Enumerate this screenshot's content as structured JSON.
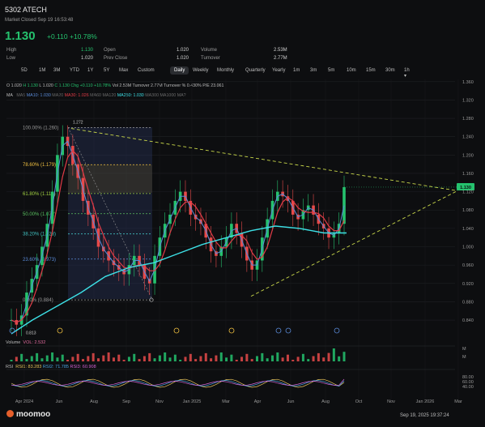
{
  "header": {
    "title": "5302  ATECH",
    "status": "Market Closed Sep 19 16:53:48",
    "price": "1.130",
    "change": "+0.110",
    "change_pct": "+10.78%"
  },
  "quote": {
    "high_label": "High",
    "high": "1.130",
    "low_label": "Low",
    "low": "1.020",
    "open_label": "Open",
    "open": "1.020",
    "prev_close_label": "Prev Close",
    "prev_close": "1.020",
    "volume_label": "Volume",
    "volume": "2.53M",
    "turnover_label": "Turnover",
    "turnover": "2.77M"
  },
  "tabs": [
    "5D",
    "1M",
    "3M",
    "YTD",
    "1Y",
    "5Y",
    "Max",
    "Custom",
    "Daily",
    "Weekly",
    "Monthly",
    "Quarterly",
    "Yearly",
    "1m",
    "3m",
    "5m",
    "10m",
    "15m",
    "30m",
    "1h ▾"
  ],
  "active_tab": "Daily",
  "info_line": {
    "o": "O 1.020",
    "h": "H 1.130",
    "l": "L 1.020",
    "c": "C 1.130",
    "chg": "Chg +0.110 +10.78%",
    "vol": "Vol 2.53M",
    "turnover": "Turnover 2.77M",
    "turnover_pct": "Turnover % 0.430%",
    "pe": "P/E 23.061"
  },
  "ma_line": {
    "ma": "MA",
    "ma5": "MA5",
    "ma10": "MA10: 1.030",
    "ma20": "MA20",
    "ma30": "MA30: 1.026",
    "ma60": "MA60",
    "ma120": "MA120",
    "ma250": "MA250: 1.030",
    "ma300": "MA300",
    "ma1000": "MA1000",
    "ma_x": "MA?"
  },
  "volume_label": "Volume",
  "vol_value": "VOL: 2.532",
  "rsi_label": "RSI",
  "rsi1": "RSI1: 83.283",
  "rsi2": "RSI2: 71.785",
  "rsi3": "RSI3: 60.908",
  "footer": {
    "logo": "moomoo",
    "timestamp": "Sep 19, 2025 19:37:24"
  },
  "colors": {
    "up": "#25c26e",
    "down": "#e74a4a",
    "ma10": "#5a8bd8",
    "ma30": "#e23b47",
    "ma250": "#3de0e6",
    "fib": "#f0c040",
    "trend": "#c9d84a"
  },
  "chart_data": {
    "type": "candlestick",
    "x_ticks": [
      "Apr 2024",
      "Jun",
      "Aug",
      "Sep",
      "Nov",
      "Jan 2025",
      "Mar",
      "Apr",
      "Jun",
      "Aug",
      "Oct",
      "Nov",
      "Jan 2026",
      "Mar"
    ],
    "y_ticks": [
      1.36,
      1.32,
      1.28,
      1.24,
      1.2,
      1.16,
      1.12,
      1.08,
      1.04,
      1.0,
      0.96,
      0.92,
      0.88,
      0.84
    ],
    "ylim": [
      0.81,
      1.365
    ],
    "last_price_tag": "1.130",
    "high_marker": "1.272",
    "low_marker": "0.813",
    "fibonacci": [
      {
        "label": "100.00% (1.260)",
        "value": 1.26
      },
      {
        "label": "78.60% (1.179)",
        "value": 1.179
      },
      {
        "label": "61.80% (1.116)",
        "value": 1.116
      },
      {
        "label": "50.00% (1.072)",
        "value": 1.072
      },
      {
        "label": "38.20% (1.028)",
        "value": 1.028
      },
      {
        "label": "23.60% (0.973)",
        "value": 0.973
      },
      {
        "label": "0.00% (0.884)",
        "value": 0.884
      }
    ],
    "close_series": [
      0.84,
      0.83,
      0.85,
      0.9,
      0.93,
      0.96,
      1.0,
      1.05,
      1.12,
      1.2,
      1.24,
      1.22,
      1.18,
      1.15,
      1.1,
      1.07,
      1.04,
      1.0,
      0.99,
      0.97,
      0.96,
      0.95,
      0.94,
      0.96,
      0.98,
      0.96,
      0.93,
      0.92,
      0.98,
      1.02,
      1.05,
      1.07,
      1.1,
      1.12,
      1.1,
      1.07,
      1.06,
      1.05,
      1.02,
      0.99,
      0.98,
      1.0,
      1.02,
      1.05,
      1.03,
      1.0,
      0.97,
      0.95,
      0.97,
      1.02,
      1.06,
      1.1,
      1.12,
      1.11,
      1.1,
      1.07,
      1.06,
      1.08,
      1.09,
      1.07,
      1.05,
      1.04,
      1.02,
      1.03,
      1.05,
      1.13
    ],
    "rsi_ticks": [
      "80.00",
      "60.00",
      "40.00"
    ],
    "vol_ticks": [
      "M",
      "M"
    ]
  }
}
